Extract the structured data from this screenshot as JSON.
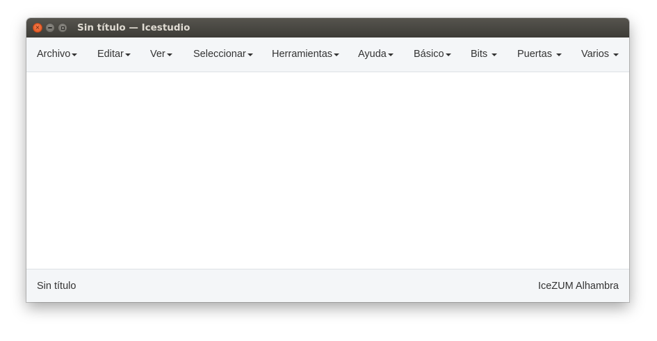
{
  "window": {
    "title": "Sin título — Icestudio",
    "controls": {
      "close_icon": "close-icon",
      "minimize_icon": "minimize-icon",
      "maximize_icon": "maximize-icon"
    }
  },
  "menubar": {
    "items": [
      {
        "label": "Archivo"
      },
      {
        "label": "Editar"
      },
      {
        "label": "Ver"
      },
      {
        "label": "Seleccionar"
      },
      {
        "label": "Herramientas"
      },
      {
        "label": "Ayuda"
      },
      {
        "label": "Básico"
      },
      {
        "label": "Bits"
      },
      {
        "label": "Puertas"
      },
      {
        "label": "Varios"
      }
    ]
  },
  "statusbar": {
    "project_name": "Sin título",
    "board": "IceZUM Alhambra"
  },
  "colors": {
    "titlebar": "#3d3c37",
    "close_button": "#e0531c",
    "menubar_bg": "#f4f6f8",
    "text": "#333333"
  }
}
